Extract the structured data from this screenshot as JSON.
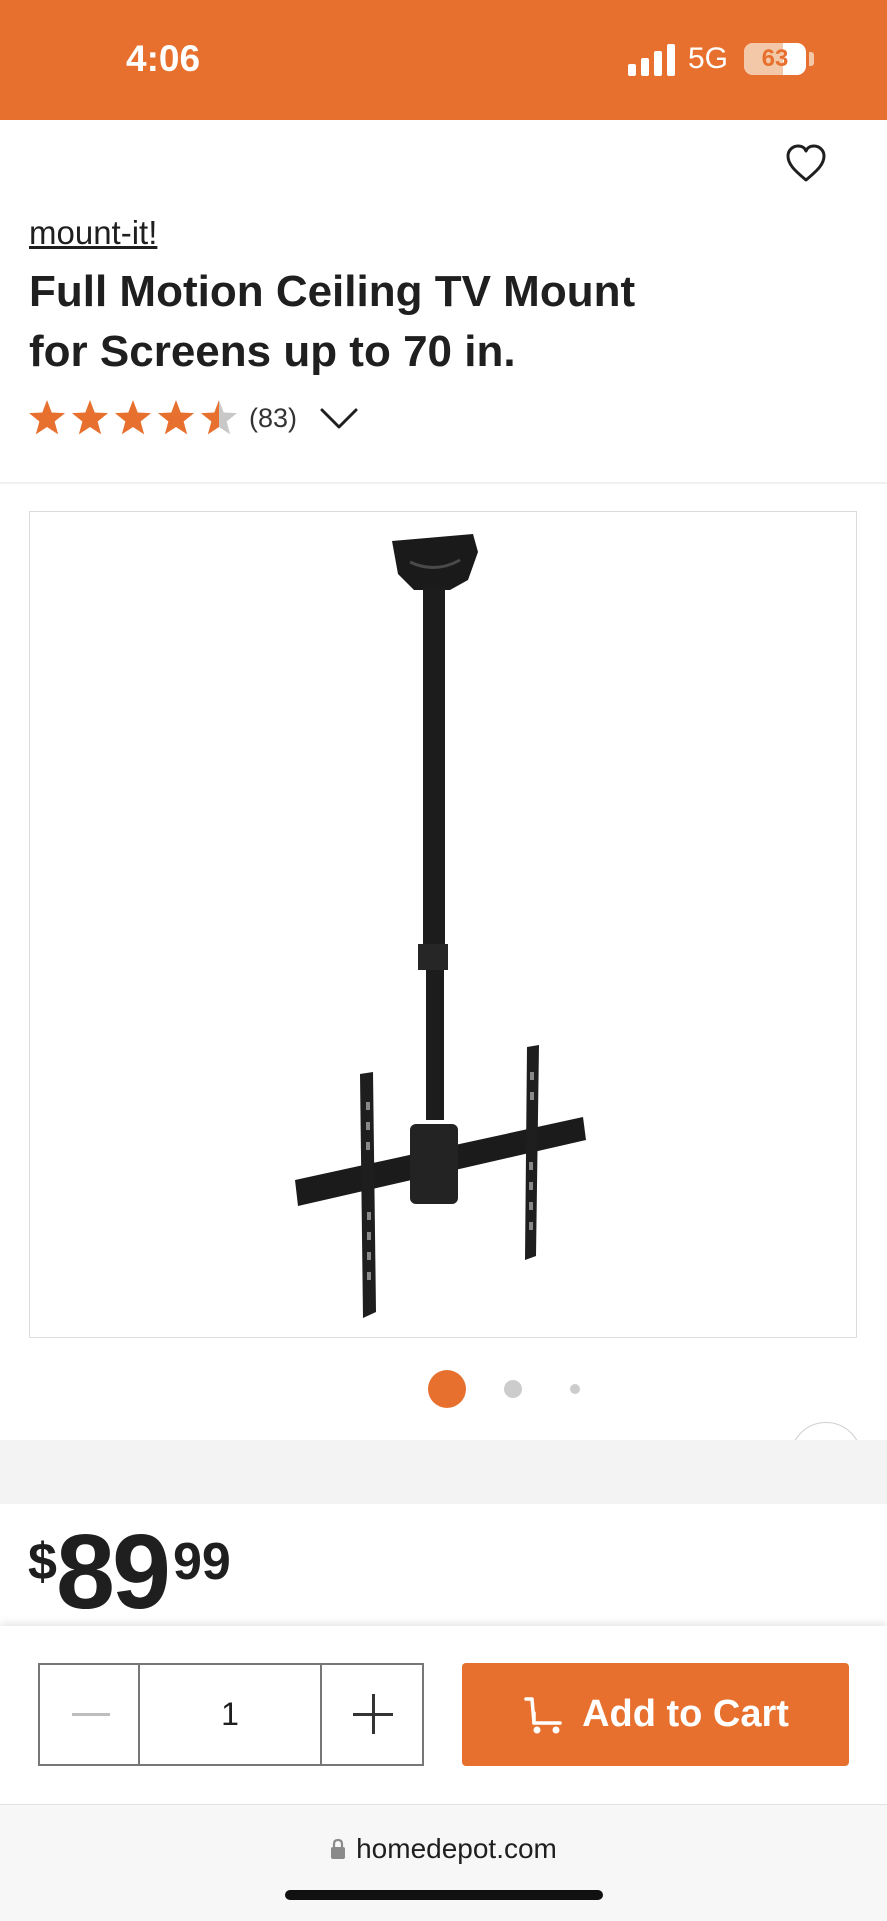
{
  "status_bar": {
    "time": "4:06",
    "network": "5G",
    "battery": "63",
    "battery_level": 0.63
  },
  "product": {
    "brand": "mount-it!",
    "title_line1": "Full Motion Ceiling TV Mount",
    "title_line2": "for Screens up to 70 in.",
    "rating": 4.5,
    "rating_max": 5,
    "review_count": "(83)"
  },
  "gallery": {
    "image_count": 3,
    "active_index": 0
  },
  "price": {
    "currency": "$",
    "dollars": "89",
    "cents": "99"
  },
  "cart": {
    "quantity": "1",
    "add_label": "Add to Cart"
  },
  "browser": {
    "url": "homedepot.com"
  },
  "colors": {
    "accent": "#e8702e",
    "star_empty": "#c8c8c8"
  },
  "icons": [
    "signal-icon",
    "battery-icon",
    "heart-icon",
    "star-icon",
    "chevron-down-icon",
    "chevron-right-icon",
    "minus-icon",
    "plus-icon",
    "cart-icon",
    "lock-icon"
  ]
}
